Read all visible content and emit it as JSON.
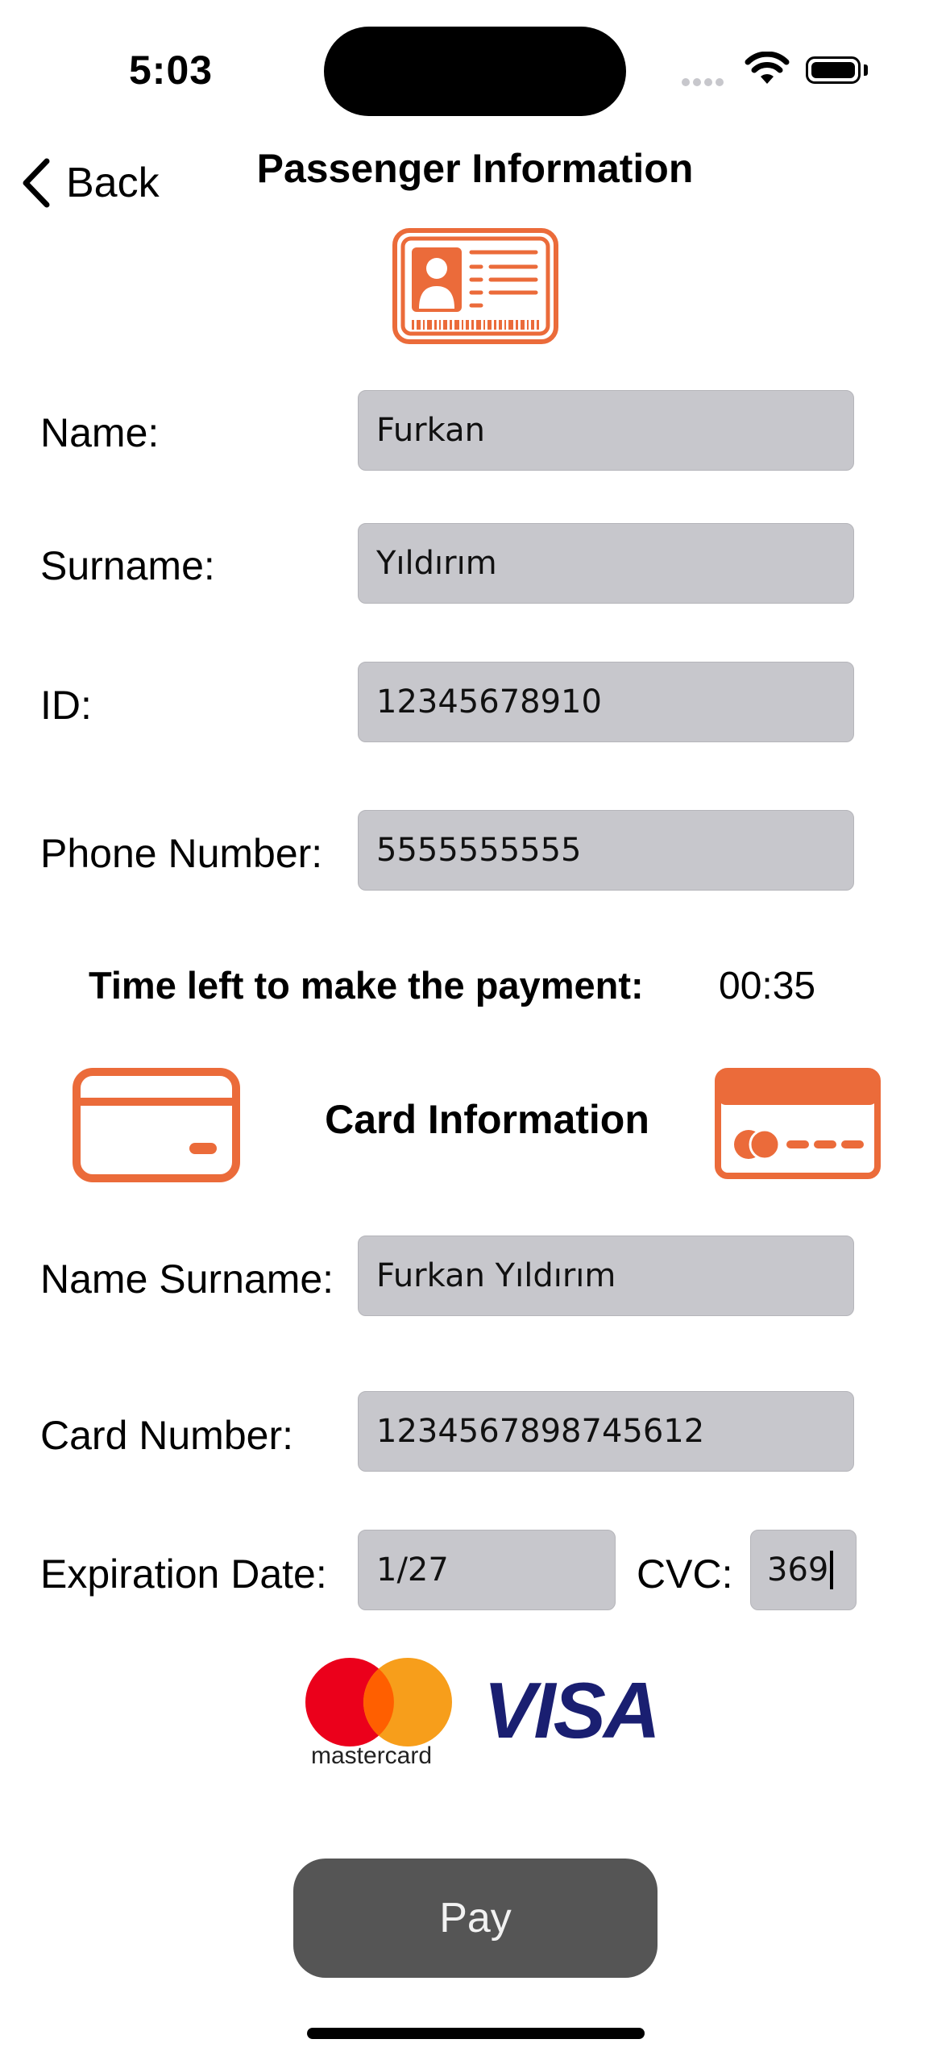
{
  "status_bar": {
    "time": "5:03"
  },
  "nav": {
    "back_label": "Back",
    "title": "Passenger Information"
  },
  "passenger": {
    "name_label": "Name:",
    "name_value": "Furkan",
    "surname_label": "Surname:",
    "surname_value": "Yıldırım",
    "id_label": "ID:",
    "id_value": "12345678910",
    "phone_label": "Phone Number:",
    "phone_value": "5555555555"
  },
  "timer": {
    "label": "Time left to make the payment:",
    "value": "00:35"
  },
  "card": {
    "title": "Card Information",
    "name_label": "Name Surname:",
    "name_value": "Furkan Yıldırım",
    "number_label": "Card Number:",
    "number_value": "1234567898745612",
    "expiration_label": "Expiration Date:",
    "expiration_value": "1/27",
    "cvc_label": "CVC:",
    "cvc_value": "369"
  },
  "brands": {
    "mastercard": "mastercard",
    "visa": "VISA"
  },
  "pay_button": "Pay",
  "colors": {
    "accent": "#EB6B3A",
    "field_bg": "#C7C7CC",
    "button_bg": "#555555"
  }
}
